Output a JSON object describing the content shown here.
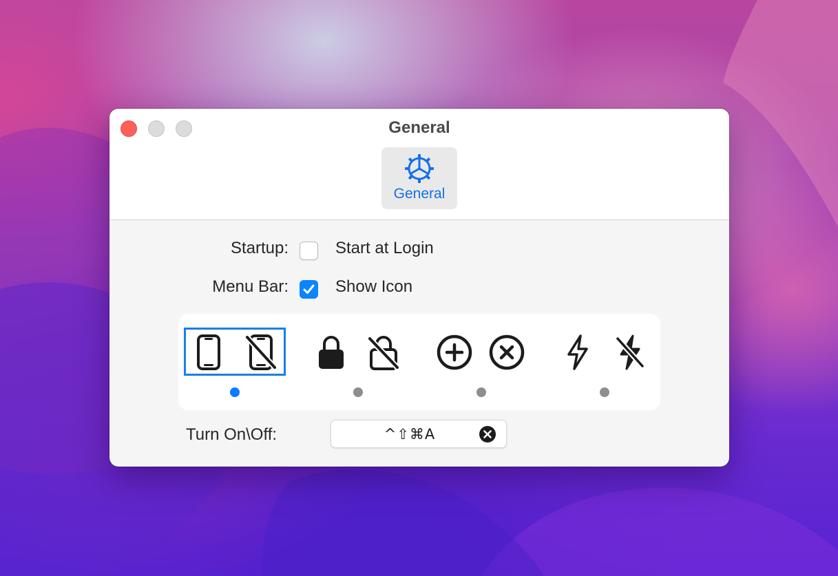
{
  "window": {
    "title": "General"
  },
  "toolbar": {
    "items": [
      {
        "label": "General",
        "icon": "gear-icon",
        "selected": true
      }
    ]
  },
  "settings": {
    "startup": {
      "label": "Startup:",
      "option": "Start at Login",
      "checked": false
    },
    "menu_bar": {
      "label": "Menu Bar:",
      "option": "Show Icon",
      "checked": true
    }
  },
  "icon_styles": [
    {
      "icons": [
        "iphone-icon",
        "iphone-slash-icon"
      ],
      "selected": true
    },
    {
      "icons": [
        "lock-icon",
        "lock-slash-icon"
      ],
      "selected": false
    },
    {
      "icons": [
        "plus-circle-icon",
        "xmark-circle-icon"
      ],
      "selected": false
    },
    {
      "icons": [
        "bolt-icon",
        "bolt-slash-icon"
      ],
      "selected": false
    }
  ],
  "hotkey": {
    "label": "Turn On\\Off:",
    "shortcut": "^⇧⌘A"
  },
  "colors": {
    "accent": "#0b84ff",
    "selection_outline": "#1a7fe6",
    "toolbar_label": "#1470e6",
    "close_button": "#fe5f57",
    "inactive_dot": "#8e8e8e"
  }
}
